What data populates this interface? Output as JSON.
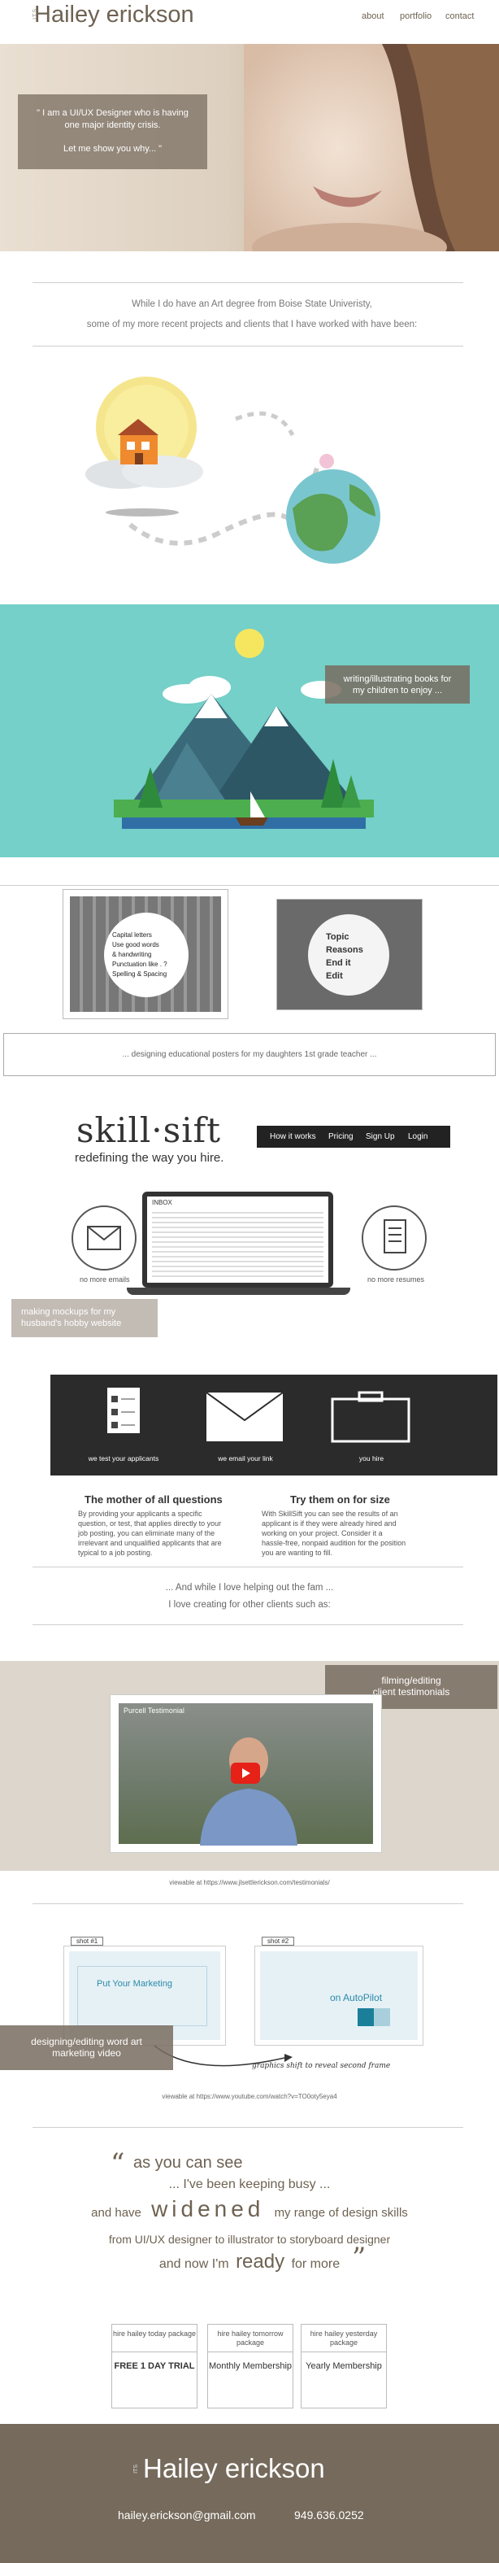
{
  "header": {
    "logo_small": "ITS",
    "logo": "Hailey erickson",
    "nav": [
      "about",
      "portfolio",
      "contact"
    ]
  },
  "hero": {
    "quote_line1": "\" I am a UI/UX Designer who is having",
    "quote_line2": "one major identity crisis.",
    "quote_line3": "Let me show you why...   \""
  },
  "intro": {
    "line1": "While I do have an Art degree from Boise State Univeristy,",
    "line2": "some of my more recent projects and clients that I have worked with have been:"
  },
  "books": {
    "tag_line1": "writing/illustrating books for",
    "tag_line2": "my children to enjoy ..."
  },
  "posters": {
    "p1": [
      "Capital letters",
      "Use good words",
      "& handwriting",
      "Punctuation like . ?",
      "Spelling & Spacing"
    ],
    "p2": [
      "Topic",
      "Reasons",
      "End it",
      "Edit"
    ],
    "caption": "... designing educational posters for my daughters 1st grade teacher ..."
  },
  "skillsift": {
    "logo": "skill·sift",
    "tagline": "redefining the way you hire.",
    "nav": [
      "How it works",
      "Pricing",
      "Sign Up",
      "Login"
    ],
    "inbox": "INBOX",
    "no_more_emails": "no more emails",
    "no_more_resumes": "no more resumes",
    "tag_line1": "making mockups for my",
    "tag_line2": "husband's hobby website",
    "steps": [
      "we test your applicants",
      "we email your link",
      "you hire"
    ],
    "h1": "The mother of all questions",
    "p1": "By providing your applicants a specific question, or test, that applies directly to your job posting, you can eliminate many of the irrelevant and unqualified applicants that are typical to a job posting.",
    "h2": "Try them on for size",
    "p2": "With SkillSift you can see the results of an applicant is if they were already hired and working on your project. Consider it a hassle-free, nonpaid audition for the position you are wanting to fill."
  },
  "transition": {
    "line1": "... And while I love helping out  the fam ...",
    "line2": "I love creating for other clients such as:"
  },
  "video": {
    "tag_line1": "filming/editing",
    "tag_line2": "client testimonials",
    "title": "Purcell Testimonial",
    "caption": "viewable at https://www.jlsettlerickson.com/testimonials/"
  },
  "motion": {
    "shot1": "shot  #1",
    "shot2": "shot  #2",
    "put_marketing": "Put Your Marketing",
    "autopilot": "on AutoPilot",
    "arrow_caption": "graphics shift to reveal second frame",
    "tag_line1": "designing/editing word art",
    "tag_line2": "marketing video",
    "caption": "viewable at https://www.youtube.com/watch?v=TO0oty5eya4"
  },
  "busy": {
    "l1": "as you can see",
    "l2": "... I've been keeping busy ...",
    "l3a": "and have",
    "l3b": "widened",
    "l3c": "my range of design skills",
    "l4": "from UI/UX designer to illustrator to storyboard designer",
    "l5a": "and now I'm",
    "l5b": "ready",
    "l5c": "for more"
  },
  "pricing": [
    {
      "top": "hire hailey today package",
      "bot": "FREE 1 DAY TRIAL"
    },
    {
      "top": "hire hailey tomorrow package",
      "bot": "Monthly Membership"
    },
    {
      "top": "hire hailey yesterday package",
      "bot": "Yearly Membership"
    }
  ],
  "footer": {
    "logo_small": "ITS",
    "name": "Hailey erickson",
    "email": "hailey.erickson@gmail.com",
    "phone": "949.636.0252"
  },
  "colors": {
    "brand": "#6e6252",
    "teal": "#74d0c8",
    "footer": "#756a5c"
  }
}
